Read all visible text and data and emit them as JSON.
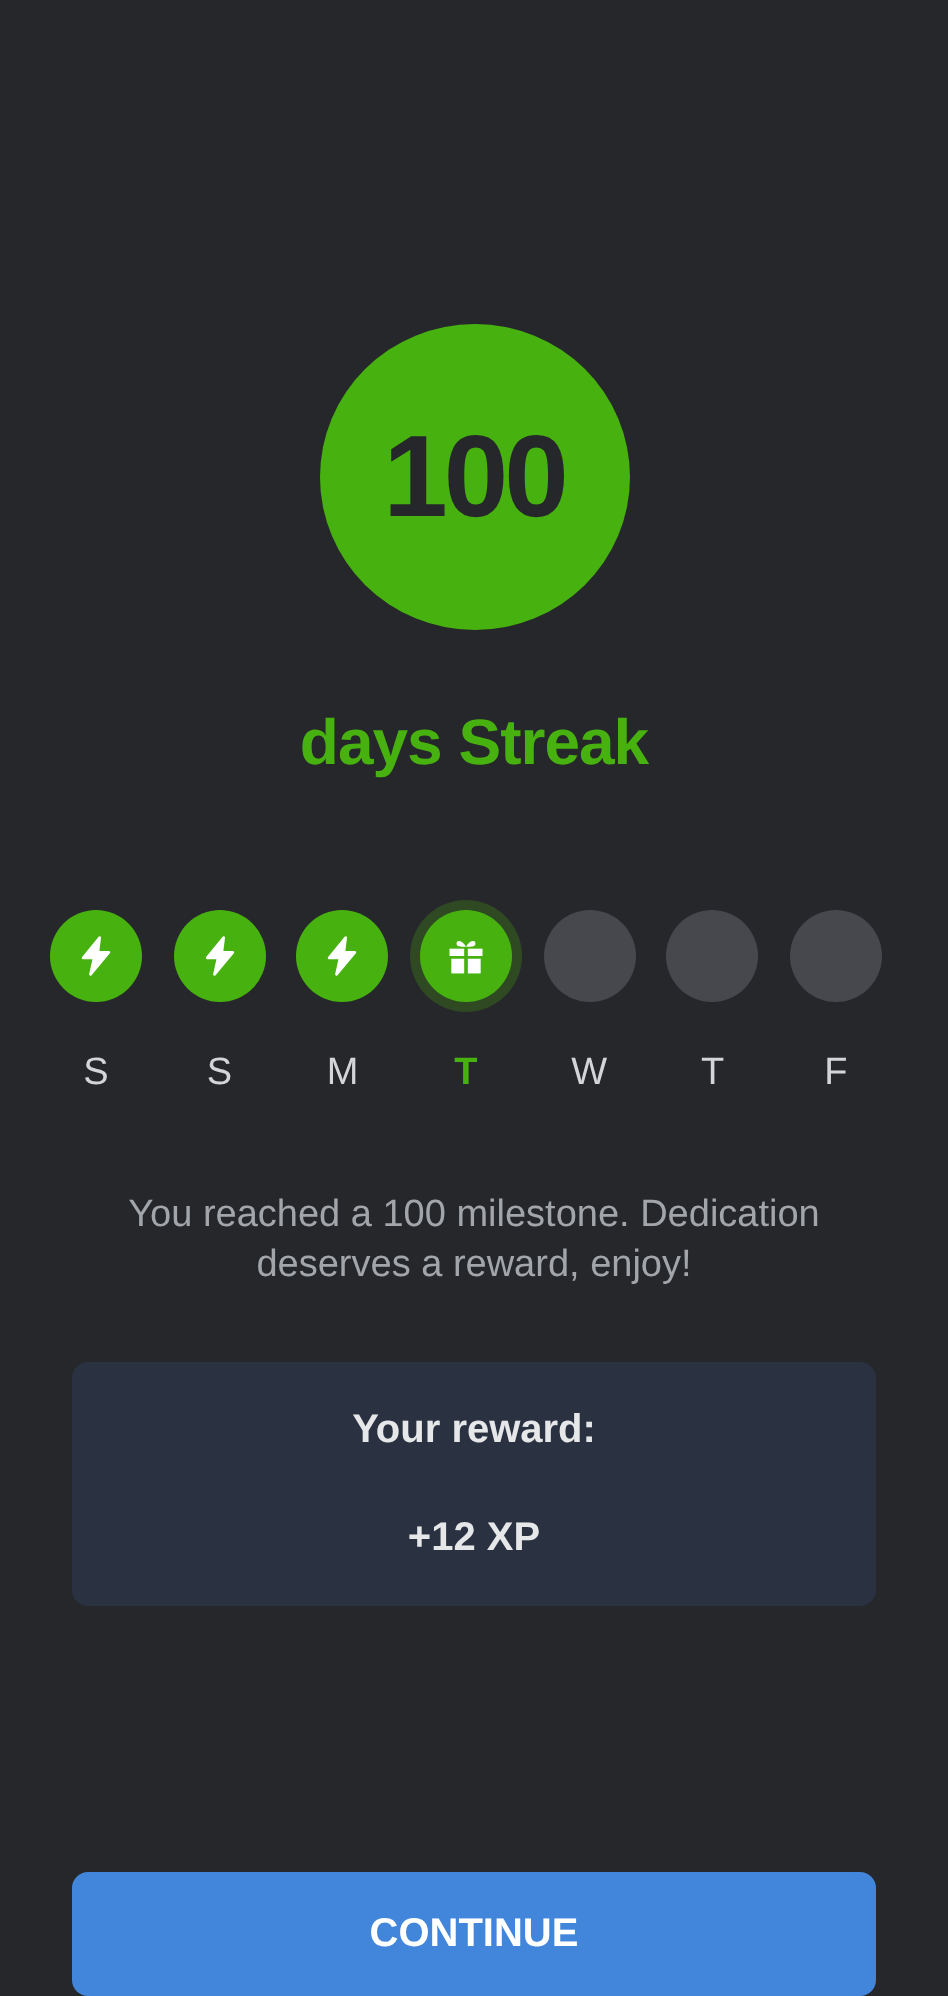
{
  "streak": {
    "count": "100",
    "label": "days Streak"
  },
  "days": [
    {
      "letter": "S",
      "kind": "done",
      "selected": false
    },
    {
      "letter": "S",
      "kind": "done",
      "selected": false
    },
    {
      "letter": "M",
      "kind": "done",
      "selected": false
    },
    {
      "letter": "T",
      "kind": "reward",
      "selected": true
    },
    {
      "letter": "W",
      "kind": "empty",
      "selected": false
    },
    {
      "letter": "T",
      "kind": "empty",
      "selected": false
    },
    {
      "letter": "F",
      "kind": "empty",
      "selected": false
    }
  ],
  "message": "You reached a 100 milestone. Dedication deserves a reward, enjoy!",
  "reward": {
    "title": "Your reward:",
    "value": "+12 XP"
  },
  "button": "CONTINUE"
}
